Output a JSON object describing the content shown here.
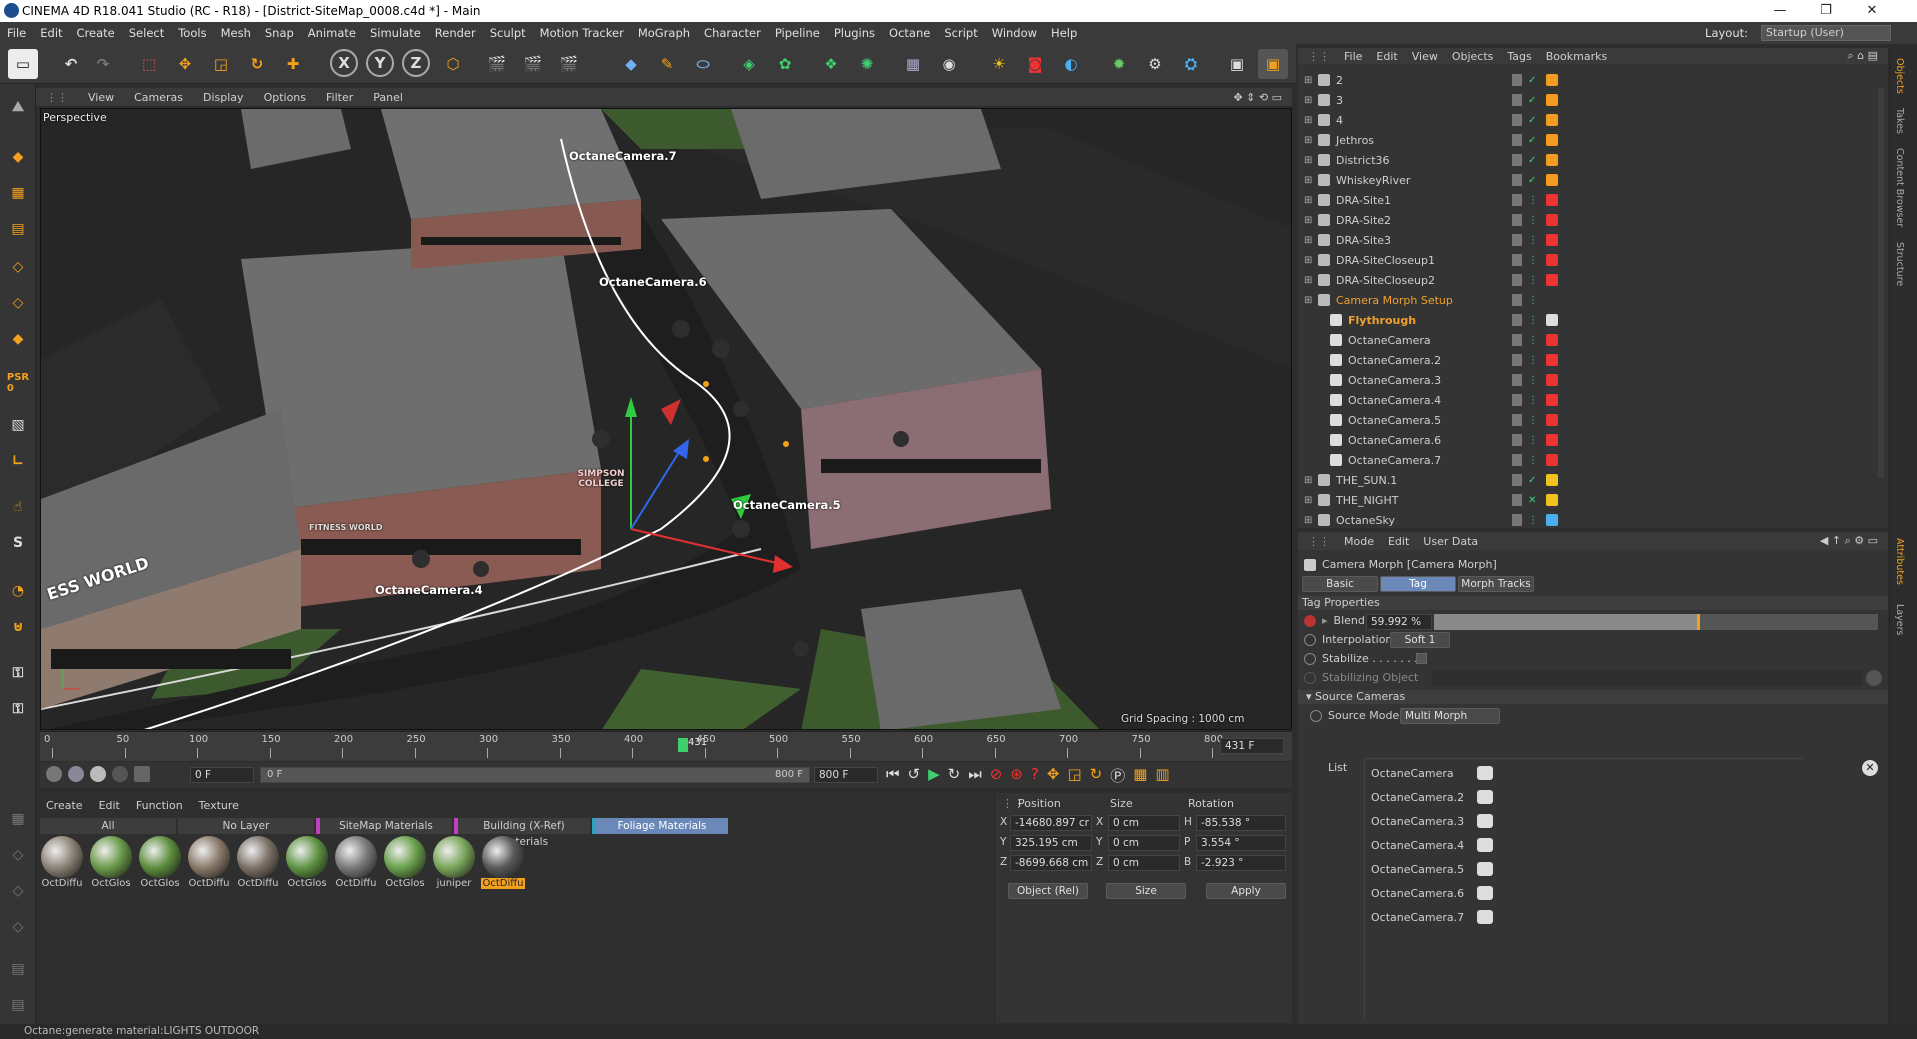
{
  "window": {
    "title": "CINEMA 4D R18.041 Studio (RC - R18) - [District-SiteMap_0008.c4d *] - Main",
    "layout_label": "Layout:",
    "layout_value": "Startup (User)"
  },
  "menu": [
    "File",
    "Edit",
    "Create",
    "Select",
    "Tools",
    "Mesh",
    "Snap",
    "Animate",
    "Simulate",
    "Render",
    "Sculpt",
    "Motion Tracker",
    "MoGraph",
    "Character",
    "Pipeline",
    "Plugins",
    "Octane",
    "Script",
    "Window",
    "Help"
  ],
  "viewport": {
    "menu": [
      "View",
      "Cameras",
      "Display",
      "Options",
      "Filter",
      "Panel"
    ],
    "name": "Perspective",
    "grid_spacing": "Grid Spacing : 1000 cm",
    "camera_labels": [
      "OctaneCamera.7",
      "OctaneCamera.6",
      "OctaneCamera.5",
      "OctaneCamera.4"
    ],
    "signs": [
      "ESS WORLD",
      "SIMPSON COLLEGE",
      "FITNESS WORLD"
    ]
  },
  "timeline": {
    "ticks": [
      "0",
      "50",
      "100",
      "150",
      "200",
      "250",
      "300",
      "350",
      "400",
      "450",
      "500",
      "550",
      "600",
      "650",
      "700",
      "750",
      "800"
    ],
    "current": "431",
    "frame_field": "431 F"
  },
  "transport": {
    "start": "0 F",
    "start2": "0 F",
    "end_inner": "800 F",
    "end": "800 F"
  },
  "materials": {
    "menu": [
      "Create",
      "Edit",
      "Function",
      "Texture"
    ],
    "tabs": [
      "All",
      "No Layer",
      "SiteMap Materials",
      "Building (X-Ref) Materials",
      "Foliage Materials"
    ],
    "items": [
      {
        "name": "OctDiffu",
        "color": "#8d8478"
      },
      {
        "name": "OctGlos",
        "color": "#6a9a4a"
      },
      {
        "name": "OctGlos",
        "color": "#5d8e3e"
      },
      {
        "name": "OctDiffu",
        "color": "#8a7a6a"
      },
      {
        "name": "OctDiffu",
        "color": "#7d7268"
      },
      {
        "name": "OctGlos",
        "color": "#5f9444"
      },
      {
        "name": "OctDiffu",
        "color": "#7a7a7a"
      },
      {
        "name": "OctGlos",
        "color": "#6aa04c"
      },
      {
        "name": "juniper",
        "color": "#7aa65a"
      },
      {
        "name": "OctDiffu",
        "color": "#595959"
      }
    ]
  },
  "coords": {
    "headers": [
      "Position",
      "Size",
      "Rotation"
    ],
    "rows": [
      {
        "axis": "X",
        "pos": "-14680.897 cr",
        "saxis": "X",
        "size": "0 cm",
        "raxis": "H",
        "rot": "-85.538 °"
      },
      {
        "axis": "Y",
        "pos": "325.195 cm",
        "saxis": "Y",
        "size": "0 cm",
        "raxis": "P",
        "rot": "3.554 °"
      },
      {
        "axis": "Z",
        "pos": "-8699.668 cm",
        "saxis": "Z",
        "size": "0 cm",
        "raxis": "B",
        "rot": "-2.923 °"
      }
    ],
    "mode": "Object (Rel)",
    "size_mode": "Size",
    "apply": "Apply"
  },
  "objects": {
    "menu": [
      "File",
      "Edit",
      "View",
      "Objects",
      "Tags",
      "Bookmarks"
    ],
    "rows": [
      {
        "name": "2",
        "indent": 0,
        "highlight": false
      },
      {
        "name": "3",
        "indent": 0,
        "highlight": false
      },
      {
        "name": "4",
        "indent": 0,
        "highlight": false
      },
      {
        "name": "Jethros",
        "indent": 0,
        "highlight": false
      },
      {
        "name": "District36",
        "indent": 0,
        "highlight": false
      },
      {
        "name": "WhiskeyRiver",
        "indent": 0,
        "highlight": false
      },
      {
        "name": "DRA-Site1",
        "indent": 0,
        "highlight": false
      },
      {
        "name": "DRA-Site2",
        "indent": 0,
        "highlight": false
      },
      {
        "name": "DRA-Site3",
        "indent": 0,
        "highlight": false
      },
      {
        "name": "DRA-SiteCloseup1",
        "indent": 0,
        "highlight": false
      },
      {
        "name": "DRA-SiteCloseup2",
        "indent": 0,
        "highlight": false
      },
      {
        "name": "Camera Morph Setup",
        "indent": 0,
        "highlight": true
      },
      {
        "name": "Flythrough",
        "indent": 1,
        "highlight": true
      },
      {
        "name": "OctaneCamera",
        "indent": 1,
        "highlight": false
      },
      {
        "name": "OctaneCamera.2",
        "indent": 1,
        "highlight": false
      },
      {
        "name": "OctaneCamera.3",
        "indent": 1,
        "highlight": false
      },
      {
        "name": "OctaneCamera.4",
        "indent": 1,
        "highlight": false
      },
      {
        "name": "OctaneCamera.5",
        "indent": 1,
        "highlight": false
      },
      {
        "name": "OctaneCamera.6",
        "indent": 1,
        "highlight": false
      },
      {
        "name": "OctaneCamera.7",
        "indent": 1,
        "highlight": false
      },
      {
        "name": "THE_SUN.1",
        "indent": 0,
        "highlight": false
      },
      {
        "name": "THE_NIGHT",
        "indent": 0,
        "highlight": false
      },
      {
        "name": "OctaneSky",
        "indent": 0,
        "highlight": false
      }
    ]
  },
  "attributes": {
    "menu": [
      "Mode",
      "Edit",
      "User Data"
    ],
    "title": "Camera Morph [Camera Morph]",
    "tabs": [
      "Basic",
      "Tag",
      "Morph Tracks"
    ],
    "section": "Tag Properties",
    "blend_label": "Blend",
    "blend_value": "59.992 %",
    "blend_fraction": 0.59992,
    "interp_label": "Interpolation",
    "interp_value": "Soft 1",
    "stabilize_label": "Stabilize . . . . . . . .",
    "stabobj_label": "Stabilizing Object",
    "source_section": "Source Cameras",
    "source_mode_label": "Source Mode",
    "source_mode_value": "Multi Morph",
    "list_label": "List",
    "list": [
      "OctaneCamera",
      "OctaneCamera.2",
      "OctaneCamera.3",
      "OctaneCamera.4",
      "OctaneCamera.5",
      "OctaneCamera.6",
      "OctaneCamera.7"
    ]
  },
  "right_tabs": [
    "Objects",
    "Takes",
    "Content Browser",
    "Structure",
    "Attributes",
    "Layers"
  ],
  "status": "Octane:generate material:LIGHTS OUTDOOR",
  "colors": {
    "accent": "#f3a11d",
    "selected_tab": "#6a88b8",
    "highlight_text": "#f0a030"
  }
}
